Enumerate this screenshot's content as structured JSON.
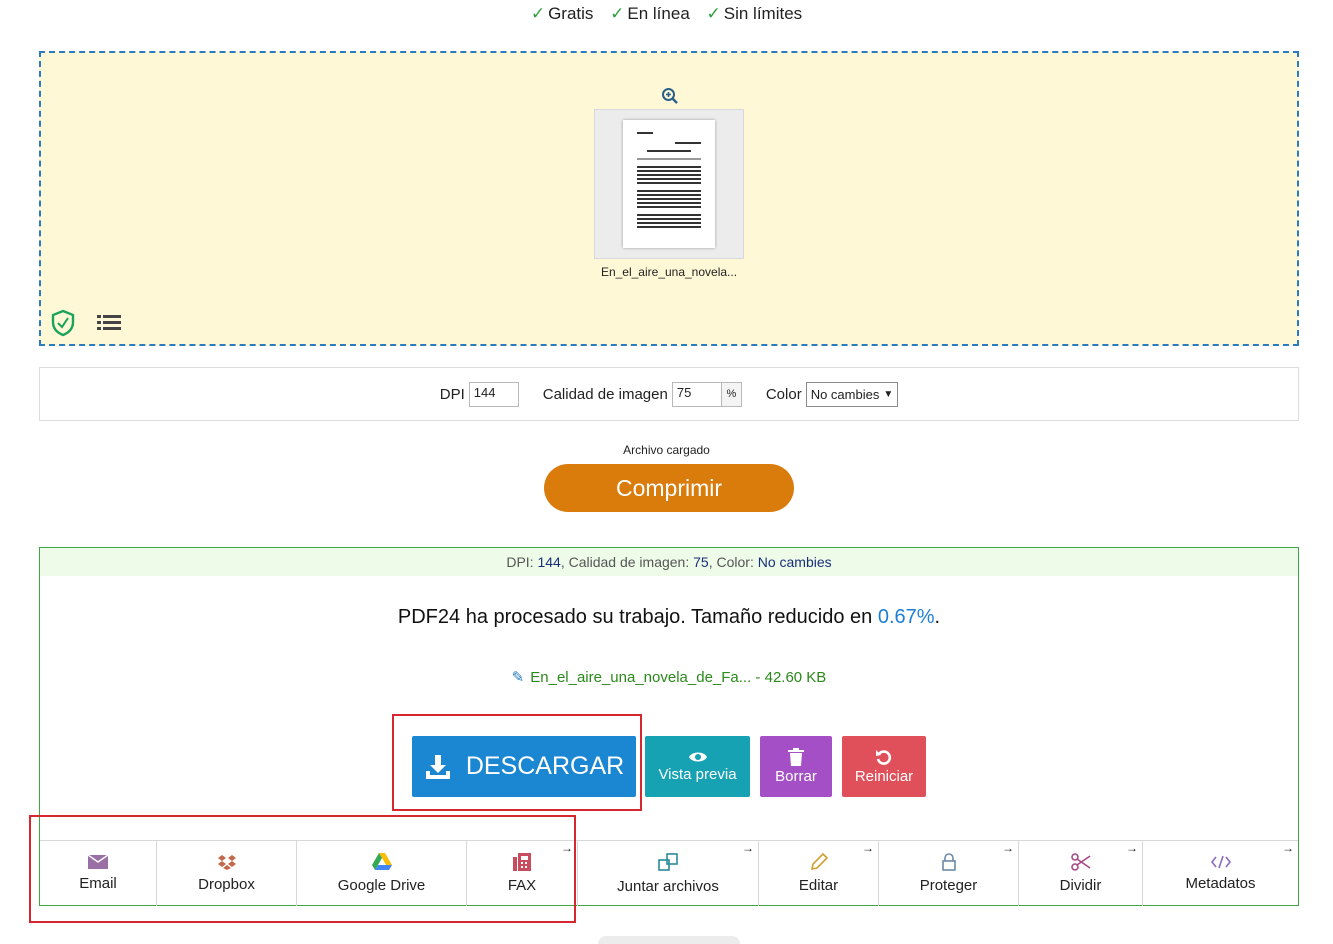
{
  "features": [
    {
      "check": "✓",
      "label": "Gratis"
    },
    {
      "check": "✓",
      "label": "En línea"
    },
    {
      "check": "✓",
      "label": "Sin límites"
    }
  ],
  "dropzone": {
    "file_name": "En_el_aire_una_novela...",
    "icons": [
      "zoom-in-icon",
      "shield-check-icon",
      "list-icon"
    ]
  },
  "options": {
    "dpi_label": "DPI",
    "dpi_value": "144",
    "quality_label": "Calidad de imagen",
    "quality_value": "75",
    "quality_unit": "%",
    "color_label": "Color",
    "color_value": "No cambies"
  },
  "upload": {
    "status": "Archivo cargado",
    "compress_label": "Comprimir"
  },
  "result": {
    "summary": {
      "dpi_label": "DPI:",
      "dpi_value": "144",
      "quality_label": "Calidad de imagen:",
      "quality_value": "75",
      "color_label": "Color:",
      "color_value": "No cambies"
    },
    "message_prefix": "PDF24 ha procesado su trabajo. Tamaño reducido en",
    "reduction": "0.67%",
    "message_suffix": ".",
    "file_name": "En_el_aire_una_novela_de_Fa...",
    "file_size": " - 42.60 KB",
    "buttons": {
      "download": "DESCARGAR",
      "preview": "Vista previa",
      "delete": "Borrar",
      "reset": "Reiniciar"
    },
    "tools": [
      {
        "label": "Email",
        "arrow": ""
      },
      {
        "label": "Dropbox",
        "arrow": ""
      },
      {
        "label": "Google Drive",
        "arrow": ""
      },
      {
        "label": "FAX",
        "arrow": "→"
      },
      {
        "label": "Juntar archivos",
        "arrow": "→"
      },
      {
        "label": "Editar",
        "arrow": "→"
      },
      {
        "label": "Proteger",
        "arrow": "→"
      },
      {
        "label": "Dividir",
        "arrow": "→"
      },
      {
        "label": "Metadatos",
        "arrow": "→"
      }
    ]
  },
  "colors": {
    "compress": "#d97c0c",
    "download": "#1b86d2",
    "preview": "#17a2b4",
    "delete": "#a54fc6",
    "reset": "#e0505a",
    "highlight": "#d7262e"
  }
}
